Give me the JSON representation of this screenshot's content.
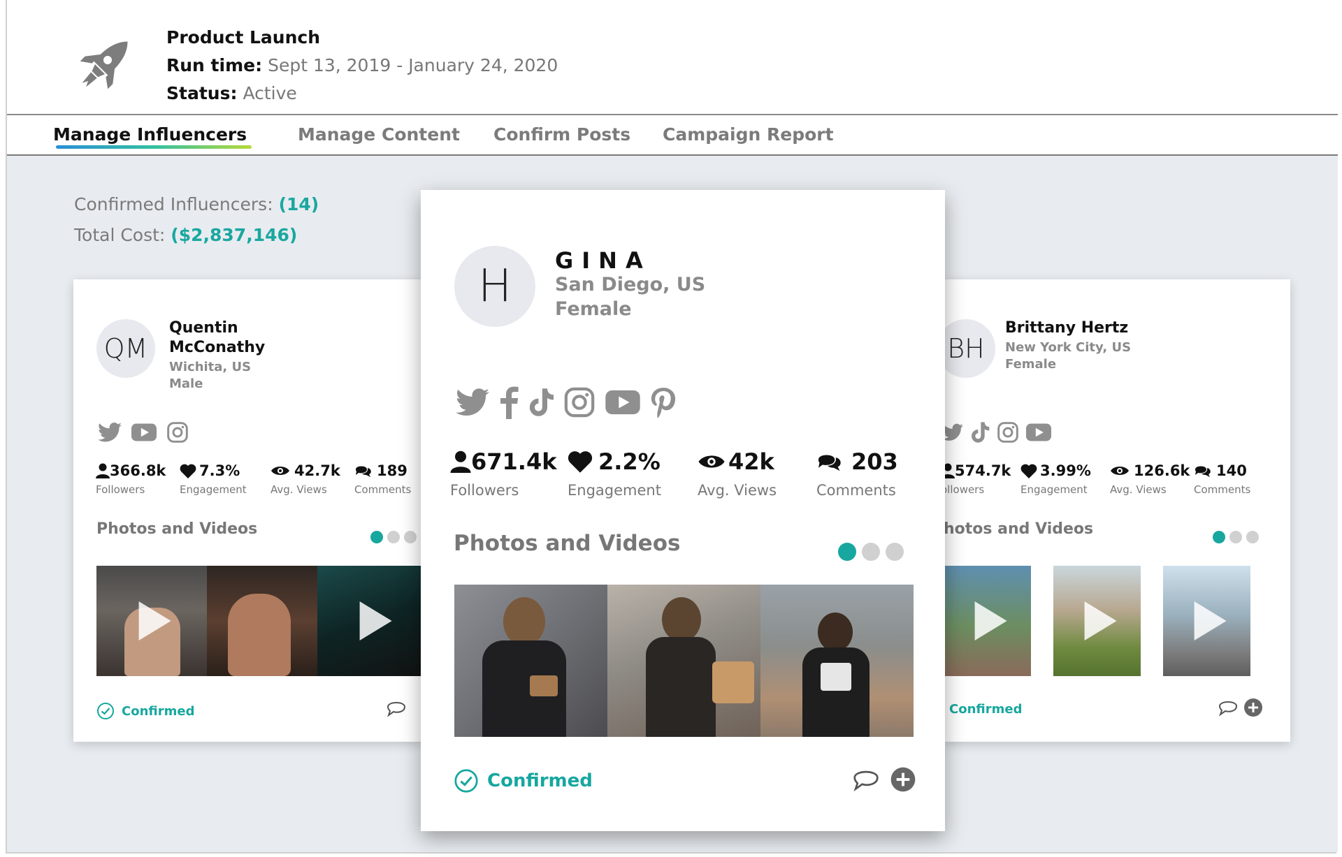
{
  "campaign": {
    "title": "Product Launch",
    "runtime_label": "Run time:",
    "runtime_value": "Sept 13, 2019 - January 24, 2020",
    "status_label": "Status:",
    "status_value": "Active"
  },
  "tabs": [
    {
      "label": "Manage Influencers",
      "active": true
    },
    {
      "label": "Manage Content",
      "active": false
    },
    {
      "label": "Confirm Posts",
      "active": false
    },
    {
      "label": "Campaign Report",
      "active": false
    }
  ],
  "summary": {
    "confirmed_label": "Confirmed Influencers:",
    "confirmed_value": "(14)",
    "cost_label": "Total Cost:",
    "cost_value": "($2,837,146)"
  },
  "labels": {
    "followers": "Followers",
    "engagement": "Engagement",
    "avg_views": "Avg. Views",
    "comments": "Comments",
    "photos_videos": "Photos and Videos",
    "confirmed": "Confirmed",
    "followers_cut": "ollowers",
    "photos_cut": "hotos and Videos"
  },
  "influencers": {
    "left": {
      "initials": "QM",
      "name_line1": "Quentin",
      "name_line2": "McConathy",
      "location": "Wichita, US",
      "gender": "Male",
      "socials": [
        "twitter-icon",
        "youtube-icon",
        "instagram-icon"
      ],
      "followers": "366.8k",
      "engagement": "7.3%",
      "avg_views": "42.7k",
      "comments": "189"
    },
    "center": {
      "initials": "H",
      "name": "GINA",
      "location": "San Diego, US",
      "gender": "Female",
      "socials": [
        "twitter-icon",
        "facebook-icon",
        "tiktok-icon",
        "instagram-icon",
        "youtube-icon",
        "pinterest-icon"
      ],
      "followers": "671.4k",
      "engagement": "2.2%",
      "avg_views": "42k",
      "comments": "203"
    },
    "right": {
      "initials": "BH",
      "name": "Brittany Hertz",
      "location": "New York City, US",
      "gender": "Female",
      "socials": [
        "twitter-icon",
        "tiktok-icon",
        "instagram-icon",
        "youtube-icon"
      ],
      "followers": "574.7k",
      "engagement": "3.99%",
      "avg_views": "126.6k",
      "comments": "140"
    }
  },
  "colors": {
    "accent": "#17a79f",
    "workspace": "#e8ecf0"
  }
}
